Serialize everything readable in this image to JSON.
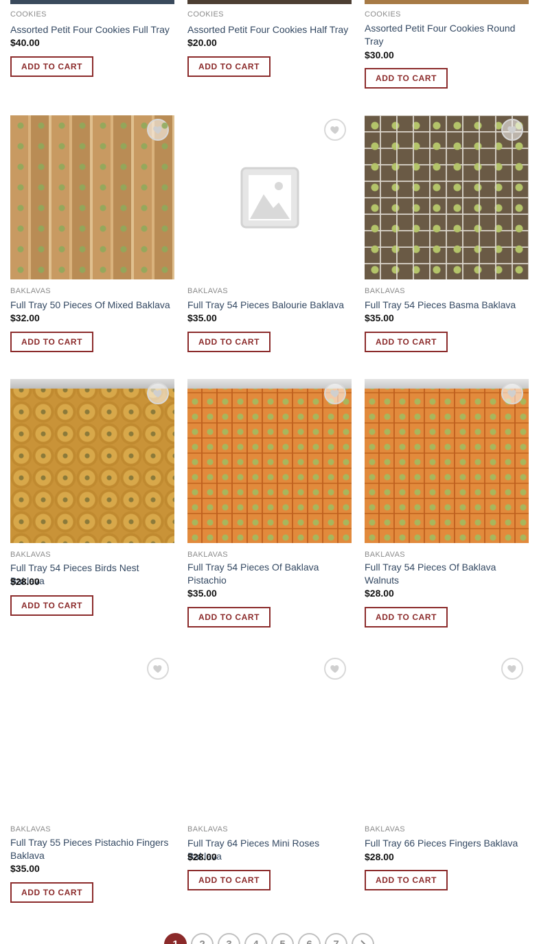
{
  "products": [
    {
      "category": "COOKIES",
      "title": "Assorted Petit Four Cookies Full Tray",
      "price": "$40.00",
      "button": "ADD TO CART",
      "image": "cookie-tray-photo"
    },
    {
      "category": "COOKIES",
      "title": "Assorted Petit Four Cookies Half Tray",
      "price": "$20.00",
      "button": "ADD TO CART",
      "image": "cookie-tray-photo"
    },
    {
      "category": "COOKIES",
      "title": "Assorted Petit Four Cookies Round Tray",
      "price": "$30.00",
      "button": "ADD TO CART",
      "image": "cookie-tray-photo"
    },
    {
      "category": "BAKLAVAS",
      "title": "Full Tray 50 Pieces Of Mixed Baklava",
      "price": "$32.00",
      "button": "ADD TO CART",
      "image": "mixed-baklava-photo"
    },
    {
      "category": "BAKLAVAS",
      "title": "Full Tray 54 Pieces Balourie Baklava",
      "price": "$35.00",
      "button": "ADD TO CART",
      "image": "placeholder-image-icon"
    },
    {
      "category": "BAKLAVAS",
      "title": "Full Tray 54 Pieces Basma Baklava",
      "price": "$35.00",
      "button": "ADD TO CART",
      "image": "basma-baklava-photo"
    },
    {
      "category": "BAKLAVAS",
      "title": "Full Tray 54 Pieces Birds Nest Baklava",
      "price": "$28.00",
      "button": "ADD TO CART",
      "image": "birds-nest-baklava-photo"
    },
    {
      "category": "BAKLAVAS",
      "title": "Full Tray 54 Pieces Of Baklava Pistachio",
      "price": "$35.00",
      "button": "ADD TO CART",
      "image": "pistachio-baklava-photo"
    },
    {
      "category": "BAKLAVAS",
      "title": "Full Tray 54 Pieces Of Baklava Walnuts",
      "price": "$28.00",
      "button": "ADD TO CART",
      "image": "walnut-baklava-photo"
    },
    {
      "category": "BAKLAVAS",
      "title": "Full Tray 55 Pieces Pistachio Fingers Baklava",
      "price": "$35.00",
      "button": "ADD TO CART",
      "image": "none"
    },
    {
      "category": "BAKLAVAS",
      "title": "Full Tray 64 Pieces Mini Roses Baklava",
      "price": "$28.00",
      "button": "ADD TO CART",
      "image": "none"
    },
    {
      "category": "BAKLAVAS",
      "title": "Full Tray 66 Pieces Fingers Baklava",
      "price": "$28.00",
      "button": "ADD TO CART",
      "image": "none"
    }
  ],
  "pagination": {
    "pages": [
      "1",
      "2",
      "3",
      "4",
      "5",
      "6",
      "7"
    ],
    "current": "1",
    "next_icon": "chevron-right-icon"
  },
  "colors": {
    "accent": "#8b2a2a",
    "link": "#334862",
    "muted": "#8a8a8a"
  }
}
